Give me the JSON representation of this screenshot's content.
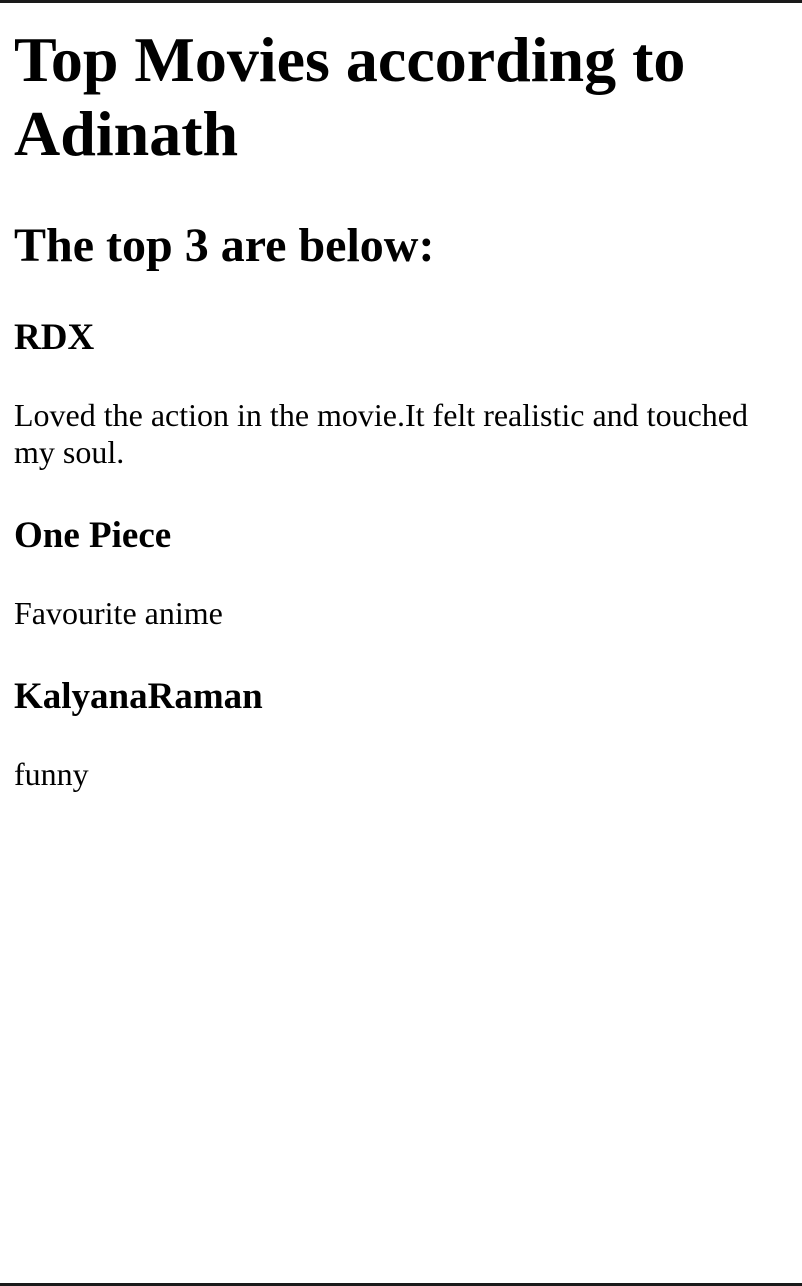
{
  "page": {
    "title": "Top Movies according to Adinath",
    "subtitle": "The top 3 are below:"
  },
  "movies": [
    {
      "title": "RDX",
      "review": "Loved the action in the movie.It felt realistic and touched my soul."
    },
    {
      "title": "One Piece",
      "review": "Favourite anime"
    },
    {
      "title": "KalyanaRaman",
      "review": "funny"
    }
  ]
}
